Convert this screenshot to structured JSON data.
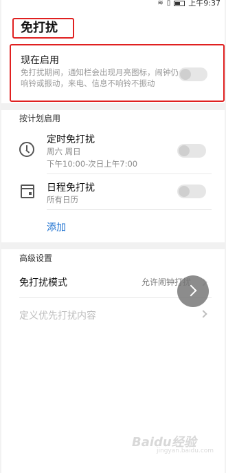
{
  "status_bar": {
    "time": "上午9:37"
  },
  "page": {
    "title": "免打扰"
  },
  "now_enabled": {
    "title": "现在启用",
    "description": "免打扰期间，通知栏会出现月亮图标，闹钟仍响铃或振动，来电、信息不响铃不振动",
    "enabled": false
  },
  "schedule": {
    "header": "按计划启用",
    "items": [
      {
        "title": "定时免打扰",
        "subtitle_line1": "周六 周日",
        "subtitle_line2": "下午10:00-次日上午7:00",
        "enabled": false,
        "icon": "clock-icon"
      },
      {
        "title": "日程免打扰",
        "subtitle_line1": "所有日历",
        "enabled": false,
        "icon": "calendar-icon"
      }
    ],
    "add_label": "添加"
  },
  "advanced": {
    "header": "高级设置",
    "mode_label": "免打扰模式",
    "mode_value": "允许闹钟打扰",
    "priority_label": "定义优先打扰内容"
  },
  "watermark": {
    "text": "Baidu经验",
    "sub": "jingyan.baidu.com"
  },
  "colors": {
    "highlight": "#e02020",
    "link": "#1a6fd0",
    "toggle_off": "#e6e6e6"
  }
}
